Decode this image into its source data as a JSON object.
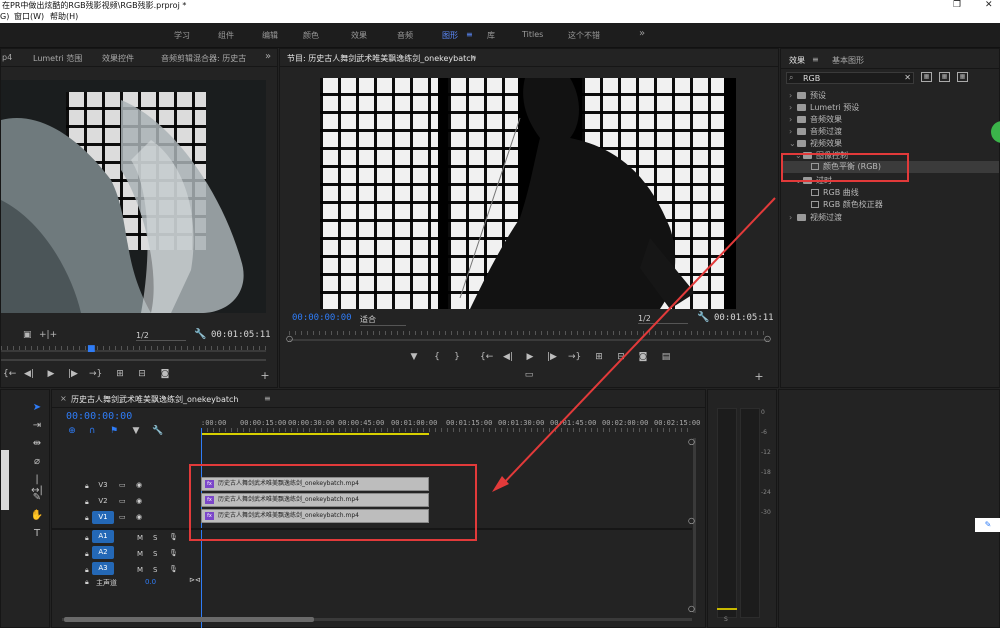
{
  "title_bar": {
    "text": "在PR中做出炫酷的RGB残影视频\\RGB残影.prproj *"
  },
  "menu": {
    "items": [
      "G)",
      "窗口(W)",
      "帮助(H)"
    ]
  },
  "window_controls": [
    "—",
    "❐",
    "✕"
  ],
  "workspaces": {
    "items": [
      "学习",
      "组件",
      "编辑",
      "颜色",
      "效果",
      "音频",
      "图形",
      "库",
      "Titles",
      "这个不错"
    ],
    "active": "图形",
    "overflow": "»"
  },
  "source_panel": {
    "tabs": [
      "p4",
      "Lumetri 范围",
      "效果控件",
      "音频剪辑混合器: 历史古"
    ],
    "overflow": "»",
    "zoom": "1/2",
    "timecode": "00:01:05:11"
  },
  "program_panel": {
    "title": "节目: 历史古人舞剑武术唯美飘逸练剑_onekeybatch",
    "timecode_current": "00:00:00:00",
    "fit": "适合",
    "zoom": "1/2",
    "timecode_duration": "00:01:05:11"
  },
  "effects_panel": {
    "tabs": [
      "效果",
      "基本图形"
    ],
    "search_value": "RGB",
    "tree": [
      {
        "label": "预设",
        "level": 0,
        "type": "folder",
        "expanded": false
      },
      {
        "label": "Lumetri 预设",
        "level": 0,
        "type": "folder",
        "expanded": false
      },
      {
        "label": "音频效果",
        "level": 0,
        "type": "folder",
        "expanded": false
      },
      {
        "label": "音频过渡",
        "level": 0,
        "type": "folder",
        "expanded": false
      },
      {
        "label": "视频效果",
        "level": 0,
        "type": "folder",
        "expanded": true
      },
      {
        "label": "图像控制",
        "level": 1,
        "type": "folder",
        "expanded": true
      },
      {
        "label": "颜色平衡 (RGB)",
        "level": 2,
        "type": "effect",
        "selected": true
      },
      {
        "label": "过时",
        "level": 1,
        "type": "folder",
        "expanded": true
      },
      {
        "label": "RGB 曲线",
        "level": 2,
        "type": "effect"
      },
      {
        "label": "RGB 颜色校正器",
        "level": 2,
        "type": "effect"
      },
      {
        "label": "视频过渡",
        "level": 0,
        "type": "folder",
        "expanded": false
      }
    ]
  },
  "timeline": {
    "sequence_name": "历史古人舞剑武术唯美飘逸练剑_onekeybatch",
    "timecode": "00:00:00:00",
    "ruler": [
      ":00:00",
      "00:00:15:00",
      "00:00:30:00",
      "00:00:45:00",
      "00:01:00:00",
      "00:01:15:00",
      "00:01:30:00",
      "00:01:45:00",
      "00:02:00:00",
      "00:02:15:00"
    ],
    "video_tracks": [
      "V3",
      "V2",
      "V1"
    ],
    "audio_tracks": [
      "A1",
      "A2",
      "A3"
    ],
    "master": {
      "label": "主声道",
      "value": "0.0"
    },
    "clips": [
      {
        "track": "V3",
        "name": "历史古人舞剑武术唯美飘逸练剑_onekeybatch.mp4",
        "badge": "fx"
      },
      {
        "track": "V2",
        "name": "历史古人舞剑武术唯美飘逸练剑_onekeybatch.mp4",
        "badge": "fx"
      },
      {
        "track": "V1",
        "name": "历史古人舞剑武术唯美飘逸练剑_onekeybatch.mp4",
        "badge": "fx"
      }
    ],
    "track_buttons": {
      "mute": "M",
      "solo": "S"
    }
  },
  "audio_meter": {
    "scale": [
      "0",
      "-6",
      "-12",
      "-18",
      "-24",
      "-30"
    ],
    "footer": "S"
  },
  "colors": {
    "accent": "#2f7cf6",
    "annotation": "#e23a3a",
    "clip": "#bdbdbd",
    "fx_badge": "#7b46c9"
  }
}
